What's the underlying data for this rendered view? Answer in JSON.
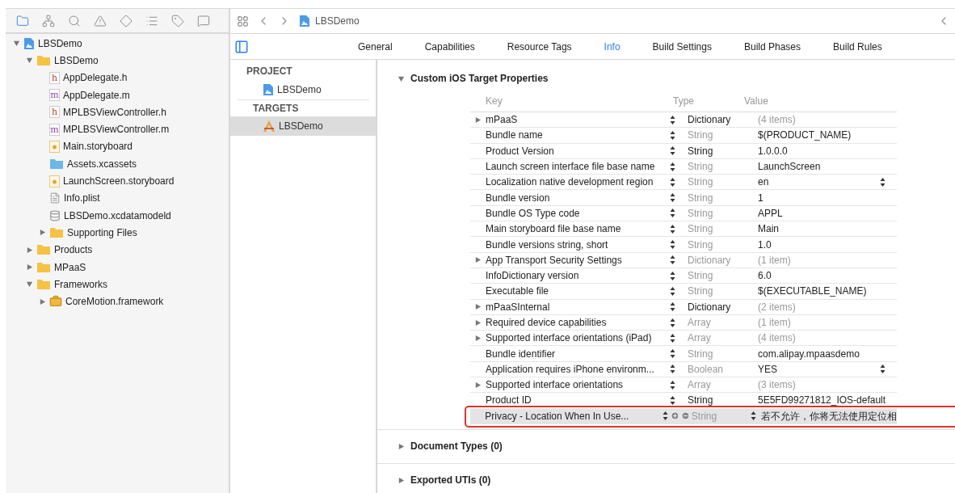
{
  "navigator_tabs": [
    {
      "kind": "folder",
      "selected": true
    },
    {
      "kind": "hierarchy",
      "selected": false
    },
    {
      "kind": "search",
      "selected": false
    },
    {
      "kind": "warning",
      "selected": false
    },
    {
      "kind": "diamond",
      "selected": false
    },
    {
      "kind": "list",
      "selected": false
    },
    {
      "kind": "tag",
      "selected": false
    },
    {
      "kind": "message",
      "selected": false
    }
  ],
  "navigator": [
    {
      "label": "LBSDemo",
      "kind": "project",
      "expanded": true,
      "children": [
        {
          "label": "LBSDemo",
          "kind": "folder",
          "expanded": true,
          "children": [
            {
              "label": "AppDelegate.h",
              "kind": "source",
              "letter": "h"
            },
            {
              "label": "AppDelegate.m",
              "kind": "source",
              "letter": "m"
            },
            {
              "label": "MPLBSViewController.h",
              "kind": "source",
              "letter": "h"
            },
            {
              "label": "MPLBSViewController.m",
              "kind": "source",
              "letter": "m"
            },
            {
              "label": "Main.storyboard",
              "kind": "storyboard"
            },
            {
              "label": "Assets.xcassets",
              "kind": "assets"
            },
            {
              "label": "LaunchScreen.storyboard",
              "kind": "storyboard"
            },
            {
              "label": "Info.plist",
              "kind": "plist"
            },
            {
              "label": "LBSDemo.xcdatamodeld",
              "kind": "datamodel"
            },
            {
              "label": "Supporting Files",
              "kind": "folder",
              "expanded": false
            }
          ]
        },
        {
          "label": "Products",
          "kind": "folder",
          "expanded": false
        },
        {
          "label": "MPaaS",
          "kind": "folder",
          "expanded": false
        },
        {
          "label": "Frameworks",
          "kind": "folder",
          "expanded": true,
          "children": [
            {
              "label": "CoreMotion.framework",
              "kind": "toolbox",
              "expanded": false
            }
          ]
        }
      ]
    }
  ],
  "jump_bar": {
    "label": "LBSDemo"
  },
  "editor_tabs": [
    {
      "label": "General",
      "selected": false
    },
    {
      "label": "Capabilities",
      "selected": false
    },
    {
      "label": "Resource Tags",
      "selected": false
    },
    {
      "label": "Info",
      "selected": true
    },
    {
      "label": "Build Settings",
      "selected": false
    },
    {
      "label": "Build Phases",
      "selected": false
    },
    {
      "label": "Build Rules",
      "selected": false
    }
  ],
  "targets_list": [
    {
      "kind": "header",
      "label": "PROJECT"
    },
    {
      "kind": "project",
      "label": "LBSDemo",
      "selected": false
    },
    {
      "kind": "header",
      "label": "TARGETS"
    },
    {
      "kind": "app",
      "label": "LBSDemo",
      "selected": true
    }
  ],
  "sections": [
    {
      "title": "Custom iOS Target Properties",
      "expanded": true
    },
    {
      "title": "Document Types (0)",
      "expanded": false
    },
    {
      "title": "Exported UTIs (0)",
      "expanded": false
    }
  ],
  "properties": {
    "columns": [
      "Key",
      "Type",
      "Value"
    ],
    "rows": [
      {
        "key": "mPaaS",
        "type": "Dictionary",
        "value": "(4 items)",
        "expandable": true,
        "emphasized": true,
        "popup": false,
        "selected": false
      },
      {
        "key": "Bundle name",
        "type": "String",
        "value": "$(PRODUCT_NAME)",
        "expandable": false,
        "emphasized": false,
        "popup": false,
        "selected": false
      },
      {
        "key": "Product Version",
        "type": "String",
        "value": "1.0.0.0",
        "expandable": false,
        "emphasized": true,
        "popup": false,
        "selected": false
      },
      {
        "key": "Launch screen interface file base name",
        "type": "String",
        "value": "LaunchScreen",
        "expandable": false,
        "emphasized": false,
        "popup": false,
        "selected": false
      },
      {
        "key": "Localization native development region",
        "type": "String",
        "value": "en",
        "expandable": false,
        "emphasized": false,
        "popup": true,
        "selected": false
      },
      {
        "key": "Bundle version",
        "type": "String",
        "value": "1",
        "expandable": false,
        "emphasized": false,
        "popup": false,
        "selected": false
      },
      {
        "key": "Bundle OS Type code",
        "type": "String",
        "value": "APPL",
        "expandable": false,
        "emphasized": false,
        "popup": false,
        "selected": false
      },
      {
        "key": "Main storyboard file base name",
        "type": "String",
        "value": "Main",
        "expandable": false,
        "emphasized": false,
        "popup": false,
        "selected": false
      },
      {
        "key": "Bundle versions string, short",
        "type": "String",
        "value": "1.0",
        "expandable": false,
        "emphasized": false,
        "popup": false,
        "selected": false
      },
      {
        "key": "App Transport Security Settings",
        "type": "Dictionary",
        "value": "(1 item)",
        "expandable": true,
        "emphasized": false,
        "popup": false,
        "selected": false
      },
      {
        "key": "InfoDictionary version",
        "type": "String",
        "value": "6.0",
        "expandable": false,
        "emphasized": false,
        "popup": false,
        "selected": false
      },
      {
        "key": "Executable file",
        "type": "String",
        "value": "$(EXECUTABLE_NAME)",
        "expandable": false,
        "emphasized": false,
        "popup": false,
        "selected": false
      },
      {
        "key": "mPaaSInternal",
        "type": "Dictionary",
        "value": "(2 items)",
        "expandable": true,
        "emphasized": true,
        "popup": false,
        "selected": false
      },
      {
        "key": "Required device capabilities",
        "type": "Array",
        "value": "(1 item)",
        "expandable": true,
        "emphasized": false,
        "popup": false,
        "selected": false
      },
      {
        "key": "Supported interface orientations (iPad)",
        "type": "Array",
        "value": "(4 items)",
        "expandable": true,
        "emphasized": false,
        "popup": false,
        "selected": false
      },
      {
        "key": "Bundle identifier",
        "type": "String",
        "value": "com.alipay.mpaasdemo",
        "expandable": false,
        "emphasized": false,
        "popup": false,
        "selected": false
      },
      {
        "key": "Application requires iPhone environm...",
        "type": "Boolean",
        "value": "YES",
        "expandable": false,
        "emphasized": false,
        "popup": true,
        "selected": false
      },
      {
        "key": "Supported interface orientations",
        "type": "Array",
        "value": "(3 items)",
        "expandable": true,
        "emphasized": false,
        "popup": false,
        "selected": false
      },
      {
        "key": "Product ID",
        "type": "String",
        "value": "5E5FD99271812_IOS-default",
        "expandable": false,
        "emphasized": true,
        "popup": false,
        "selected": false
      },
      {
        "key": "Privacy - Location When In Use...",
        "type": "String",
        "value": "若不允许，你将无法使用定位相",
        "expandable": false,
        "emphasized": false,
        "popup": false,
        "selected": true
      }
    ]
  }
}
